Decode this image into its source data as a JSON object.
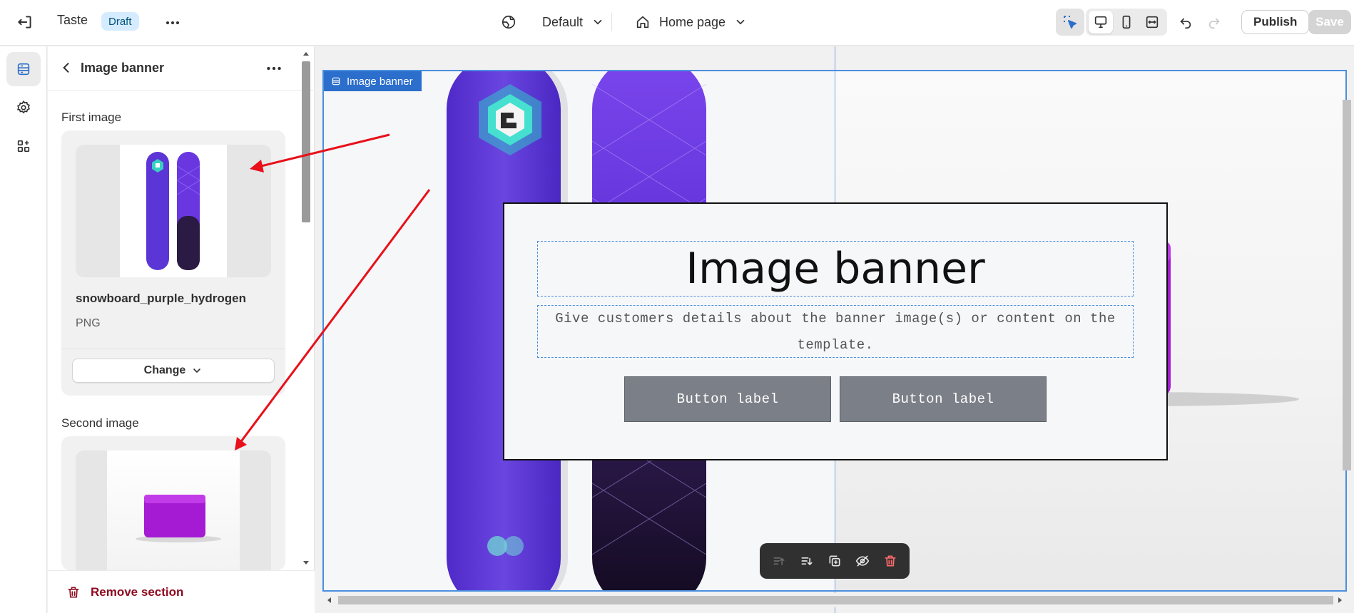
{
  "topbar": {
    "store_name": "Taste",
    "status_badge": "Draft",
    "theme_label": "Default",
    "page_label": "Home page",
    "publish_label": "Publish",
    "save_label": "Save"
  },
  "sidebar": {
    "title": "Image banner",
    "first_image_label": "First image",
    "first_image": {
      "filename": "snowboard_purple_hydrogen",
      "type": "PNG"
    },
    "change_label": "Change",
    "second_image_label": "Second image",
    "remove_label": "Remove section"
  },
  "preview": {
    "section_tag": "Image banner",
    "heading": "Image banner",
    "description": "Give customers details about the banner image(s) or content on the template.",
    "button1": "Button label",
    "button2": "Button label"
  },
  "colors": {
    "accent": "#2c6ecb",
    "danger": "#8e0b21",
    "annotation_arrow": "#e8101a"
  },
  "icons": [
    "exit-icon",
    "more-icon",
    "globe-icon",
    "chevron-down-icon",
    "home-icon",
    "inspector-icon",
    "desktop-icon",
    "mobile-icon",
    "fullwidth-icon",
    "undo-icon",
    "redo-icon",
    "sections-icon",
    "settings-icon",
    "apps-icon",
    "back-icon",
    "trash-icon"
  ]
}
